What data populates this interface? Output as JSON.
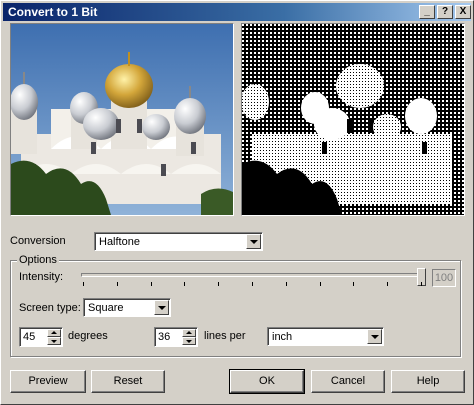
{
  "window": {
    "title": "Convert to 1 Bit",
    "controls": {
      "minimize": "_",
      "help": "?",
      "close": "X"
    }
  },
  "previews": {
    "original": {
      "name": "original-preview-image"
    },
    "result": {
      "name": "result-preview-image"
    }
  },
  "conversion": {
    "label": "Conversion",
    "value": "Halftone"
  },
  "options": {
    "legend": "Options",
    "intensity": {
      "label": "Intensity:",
      "value": "100",
      "level": 1.0
    },
    "screen_type": {
      "label": "Screen type:",
      "value": "Square"
    },
    "angle": {
      "value": "45",
      "unit": "degrees"
    },
    "frequency": {
      "value": "36",
      "unit": "lines per"
    },
    "units": {
      "value": "inch"
    }
  },
  "buttons": {
    "preview": "Preview",
    "reset": "Reset",
    "ok": "OK",
    "cancel": "Cancel",
    "help": "Help"
  },
  "colors": {
    "title_start": "#0a246a",
    "title_end": "#a6caf0",
    "face": "#d4d0c8"
  }
}
